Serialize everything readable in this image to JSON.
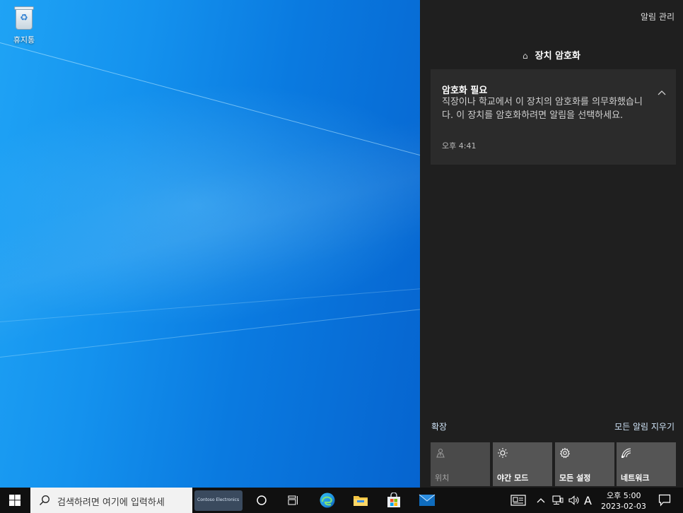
{
  "desktop": {
    "icons": [
      {
        "label": "휴지통",
        "icon": "recycle-bin-icon"
      }
    ]
  },
  "action_center": {
    "manage_label": "알림 관리",
    "group_title": "장치 암호화",
    "notification": {
      "title": "암호화 필요",
      "body": "직장이나 학교에서 이 장치의 암호화를 의무화했습니다. 이 장치를 암호화하려면 알림을 선택하세요.",
      "time": "오후 4:41"
    },
    "expand_label": "확장",
    "clear_all_label": "모든 알림 지우기",
    "quick_actions": [
      {
        "label": "위치",
        "icon": "location-icon",
        "enabled": false
      },
      {
        "label": "야간 모드",
        "icon": "night-light-icon",
        "enabled": true
      },
      {
        "label": "모든 설정",
        "icon": "settings-gear-icon",
        "enabled": true
      },
      {
        "label": "네트워크",
        "icon": "network-icon",
        "enabled": true
      }
    ]
  },
  "taskbar": {
    "search_placeholder": "검색하려면 여기에 입력하세",
    "app_thumb_label": "Contoso Electronics",
    "ime_label": "A",
    "clock_time": "오후 5:00",
    "clock_date": "2023-02-03"
  },
  "colors": {
    "panel_bg": "#1f1f1f",
    "card_bg": "#2b2b2b",
    "tile_bg": "#555555",
    "taskbar_bg": "#101010",
    "link_color": "#cfe3f7"
  }
}
